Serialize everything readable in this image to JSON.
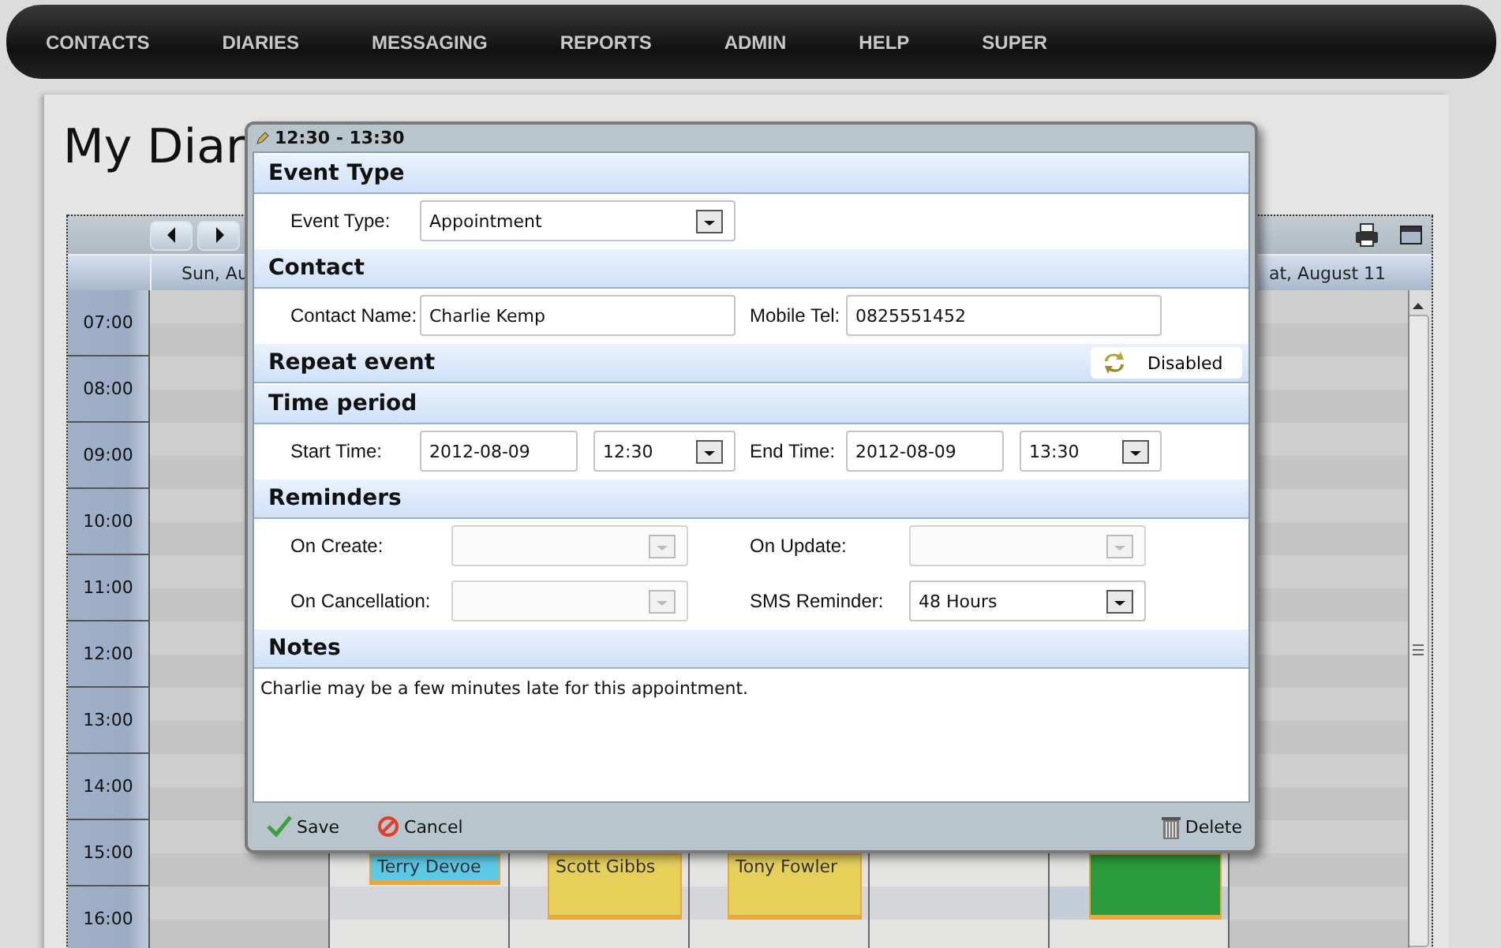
{
  "nav": [
    {
      "label": "CONTACTS"
    },
    {
      "label": "DIARIES"
    },
    {
      "label": "MESSAGING"
    },
    {
      "label": "REPORTS"
    },
    {
      "label": "ADMIN"
    },
    {
      "label": "HELP"
    },
    {
      "label": "SUPER"
    }
  ],
  "page_title": "My Diar",
  "calendar": {
    "day_headers": [
      "Sun, Au",
      "at, August 11"
    ],
    "hours": [
      "07:00",
      "08:00",
      "09:00",
      "10:00",
      "11:00",
      "12:00",
      "13:00",
      "14:00",
      "15:00",
      "16:00"
    ],
    "events": [
      {
        "name": "Terry Devoe",
        "color": "#5bc8e6"
      },
      {
        "name": "Scott Gibbs",
        "color": "#e6d05a"
      },
      {
        "name": "Tony Fowler",
        "color": "#e6d05a"
      },
      {
        "color": "#2a9a3a"
      }
    ]
  },
  "dialog": {
    "title": "12:30 - 13:30",
    "sections": [
      {
        "title": "Event Type",
        "kind": "form",
        "rows": [
          [
            {
              "label": "Event Type:",
              "fields": [
                {
                  "kind": "select",
                  "value": "Appointment",
                  "disabled": false
                }
              ]
            }
          ]
        ]
      },
      {
        "title": "Contact",
        "kind": "form",
        "rows": [
          [
            {
              "label": "Contact Name:",
              "fields": [
                {
                  "kind": "text",
                  "value": "Charlie Kemp"
                }
              ]
            },
            {
              "label": "Mobile Tel:",
              "fields": [
                {
                  "kind": "text",
                  "value": "0825551452"
                }
              ]
            }
          ]
        ]
      },
      {
        "title": "Repeat event",
        "kind": "toggle",
        "toggle": "Disabled"
      },
      {
        "title": "Time period",
        "kind": "form",
        "rows": [
          [
            {
              "label": "Start Time:",
              "fields": [
                {
                  "kind": "date",
                  "value": "2012-08-09"
                },
                {
                  "kind": "time",
                  "value": "12:30",
                  "disabled": false
                }
              ]
            },
            {
              "label": "End Time:",
              "fields": [
                {
                  "kind": "date",
                  "value": "2012-08-09"
                },
                {
                  "kind": "time",
                  "value": "13:30",
                  "disabled": false
                }
              ]
            }
          ]
        ]
      },
      {
        "title": "Reminders",
        "kind": "form",
        "rows": [
          [
            {
              "label": "On Create:",
              "fields": [
                {
                  "kind": "reminder",
                  "disabled": true
                }
              ]
            },
            {
              "label": "On Update:",
              "fields": [
                {
                  "kind": "reminder",
                  "disabled": true
                }
              ]
            }
          ],
          [
            {
              "label": "On Cancellation:",
              "fields": [
                {
                  "kind": "reminder",
                  "disabled": true
                }
              ]
            },
            {
              "label": "SMS Reminder:",
              "fields": [
                {
                  "kind": "reminder",
                  "value": "48 Hours",
                  "disabled": false
                }
              ]
            }
          ]
        ]
      },
      {
        "title": "Notes",
        "kind": "notes",
        "value": "Charlie may be a few minutes late for this appointment."
      }
    ],
    "buttons": [
      {
        "label": "Save",
        "kind": "save"
      },
      {
        "label": "Cancel",
        "kind": "cancel"
      },
      {
        "label": "Delete",
        "kind": "delete"
      }
    ]
  }
}
